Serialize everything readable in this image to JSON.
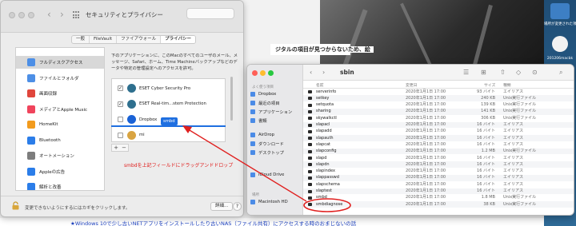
{
  "background_page": {
    "heading": "ジタルの項目が見つからないため、絵",
    "footer_link": "★Windows 10で少し古いNETアプリをインストールしたり古いNAS（ファイル共有）にアクセスする時のおまじないの話"
  },
  "desktop": {
    "labels": [
      "場所が変更された項目",
      "201206macbk"
    ]
  },
  "settings": {
    "title": "セキュリティとプライバシー",
    "tabs": [
      "一般",
      "FileVault",
      "ファイアウォール",
      "プライバシー"
    ],
    "active_tab": "プライバシー",
    "categories": [
      {
        "label": "フルディスクアクセス",
        "icon": "folder-icon",
        "color": "#4d8fe6"
      },
      {
        "label": "ファイルとフォルダ",
        "icon": "folder-icon",
        "color": "#4d8fe6"
      },
      {
        "label": "画面収録",
        "icon": "screen-record-icon",
        "color": "#e0463c"
      },
      {
        "label": "メディアとApple Music",
        "icon": "music-icon",
        "color": "#f0445c"
      },
      {
        "label": "HomeKit",
        "icon": "home-icon",
        "color": "#f29b1d"
      },
      {
        "label": "Bluetooth",
        "icon": "bluetooth-icon",
        "color": "#2b7de9"
      },
      {
        "label": "オートメーション",
        "icon": "gear-icon",
        "color": "#7d7d7d"
      },
      {
        "label": "Appleの広告",
        "icon": "ads-icon",
        "color": "#2b7de9"
      },
      {
        "label": "解析と改善",
        "icon": "chart-icon",
        "color": "#2b7de9"
      }
    ],
    "description": "下のアプリケーションに、このMacのすべてのユーザのメール、メッセージ、Safari、ホーム、Time Machineバックアップなどのデータや特定の管理設定へのアクセスを許可。",
    "apps": [
      {
        "label": "ESET Cyber Security Pro",
        "checked": true,
        "icon": "eset-icon",
        "color": "#2e6f8e"
      },
      {
        "label": "ESET Real-tim...stem Protection",
        "checked": true,
        "icon": "eset-icon",
        "color": "#2e6f8e"
      },
      {
        "label": "Dropbox",
        "checked": false,
        "icon": "dropbox-icon",
        "color": "#1a62d6"
      },
      {
        "label": "mi",
        "checked": false,
        "icon": "mi-icon",
        "color": "#d9a441"
      }
    ],
    "drag_chip": "smbd",
    "annotation": "smbdを上記フィールドにドラッグアンドドロップ",
    "lock_text": "変更できないようにするにはカギをクリックします。",
    "details_button": "詳細...",
    "help_button": "?"
  },
  "finder": {
    "folder": "sbin",
    "sidebar_sections": [
      "よく使う項目",
      "場所"
    ],
    "sidebar_items": [
      "Dropbox",
      "最近の項目",
      "アプリケーション",
      "書類",
      "AirDrop",
      "ダウンロード",
      "デスクトップ",
      "iCloud Drive",
      "Macintosh HD"
    ],
    "columns": {
      "name": "名前",
      "date": "変更日",
      "size": "サイズ",
      "kind": "種類"
    },
    "rows": [
      {
        "name": "serverinfo",
        "date": "2020年1月1日 17:00",
        "size": "93 バイト",
        "kind": "エイリアス"
      },
      {
        "name": "setkey",
        "date": "2020年1月1日 17:00",
        "size": "240 KB",
        "kind": "Unix実行ファイル"
      },
      {
        "name": "setquota",
        "date": "2020年1月1日 17:00",
        "size": "139 KB",
        "kind": "Unix実行ファイル"
      },
      {
        "name": "sharing",
        "date": "2020年1月1日 17:00",
        "size": "141 KB",
        "kind": "Unix実行ファイル"
      },
      {
        "name": "skywalkctl",
        "date": "2020年1月1日 17:00",
        "size": "306 KB",
        "kind": "Unix実行ファイル"
      },
      {
        "name": "slapacl",
        "date": "2020年1月1日 17:00",
        "size": "16 バイト",
        "kind": "エイリアス"
      },
      {
        "name": "slapadd",
        "date": "2020年1月1日 17:00",
        "size": "16 バイト",
        "kind": "エイリアス"
      },
      {
        "name": "slapauth",
        "date": "2020年1月1日 17:00",
        "size": "16 バイト",
        "kind": "エイリアス"
      },
      {
        "name": "slapcat",
        "date": "2020年1月1日 17:00",
        "size": "16 バイト",
        "kind": "エイリアス"
      },
      {
        "name": "slapconfig",
        "date": "2020年1月1日 17:00",
        "size": "1.2 MB",
        "kind": "Unix実行ファイル"
      },
      {
        "name": "slapd",
        "date": "2020年1月1日 17:00",
        "size": "16 バイト",
        "kind": "エイリアス"
      },
      {
        "name": "slapdn",
        "date": "2020年1月1日 17:00",
        "size": "16 バイト",
        "kind": "エイリアス"
      },
      {
        "name": "slapindex",
        "date": "2020年1月1日 17:00",
        "size": "16 バイト",
        "kind": "エイリアス"
      },
      {
        "name": "slappasswd",
        "date": "2020年1月1日 17:00",
        "size": "16 バイト",
        "kind": "エイリアス"
      },
      {
        "name": "slapschema",
        "date": "2020年1月1日 17:00",
        "size": "16 バイト",
        "kind": "エイリアス"
      },
      {
        "name": "slaptest",
        "date": "2020年1月1日 17:00",
        "size": "16 バイト",
        "kind": "エイリアス"
      },
      {
        "name": "smbd",
        "date": "2020年1月1日 17:00",
        "size": "1.8 MB",
        "kind": "Unix実行ファイル"
      },
      {
        "name": "smbdiagnose",
        "date": "2020年1月1日 17:00",
        "size": "38 KB",
        "kind": "Unix実行ファイル"
      }
    ],
    "highlighted_row": "smbd"
  },
  "colors": {
    "annotation_red": "#e0201f",
    "accent_blue": "#1f6fe0"
  }
}
